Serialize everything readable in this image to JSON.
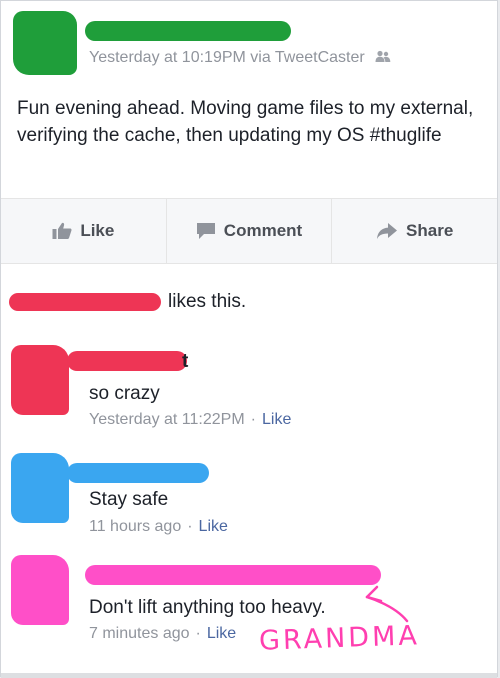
{
  "post": {
    "meta": "Yesterday at 10:19PM via TweetCaster",
    "text": "Fun evening ahead. Moving game files to my external, verifying the cache, then updating my OS #thuglife",
    "colors": {
      "redaction": "#1f9e3a",
      "meta": "#90949c"
    }
  },
  "actions": {
    "like": "Like",
    "comment": "Comment",
    "share": "Share"
  },
  "likes": {
    "text": "likes this.",
    "redaction_color": "#ee3555"
  },
  "comments": [
    {
      "partial_name": "t",
      "text": "so crazy",
      "time": "Yesterday at 11:22PM",
      "like_label": "Like",
      "dot": "·",
      "redaction_color": "#ee3555"
    },
    {
      "text": "Stay safe",
      "time": "11 hours ago",
      "like_label": "Like",
      "dot": "·",
      "redaction_color": "#3aa6f0"
    },
    {
      "text": "Don't lift anything too heavy.",
      "time": "7 minutes ago",
      "like_label": "Like",
      "dot": "·",
      "redaction_color": "#ff4fc8"
    }
  ],
  "annotation": {
    "text": "GRANDMA",
    "color": "#ff3fb0"
  },
  "icons": [
    "friends-icon",
    "thumbs-up-icon",
    "comment-icon",
    "share-arrow-icon",
    "handwritten-arrow-icon"
  ]
}
